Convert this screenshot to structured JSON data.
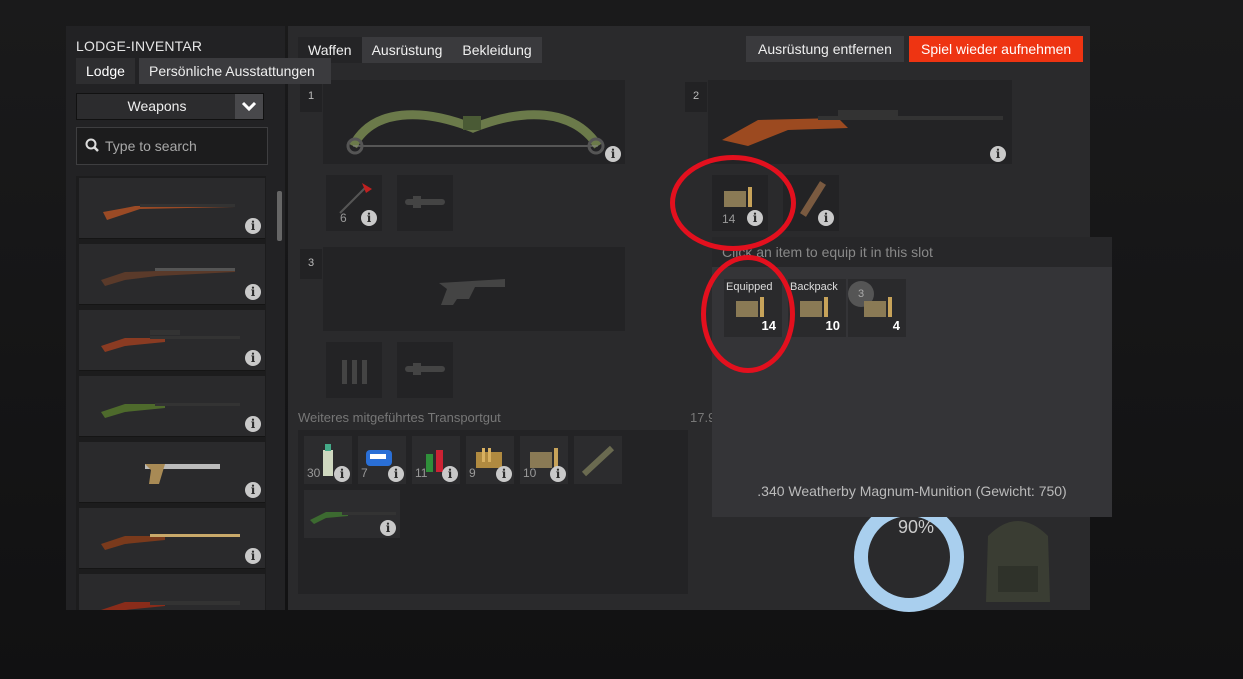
{
  "sidebar": {
    "title": "LODGE-INVENTAR",
    "tabs": [
      "Lodge",
      "Persönliche Ausstattungen"
    ],
    "category": "Weapons",
    "search_placeholder": "Type to search"
  },
  "tabs": [
    "Waffen",
    "Ausrüstung",
    "Bekleidung"
  ],
  "buttons": {
    "remove": "Ausrüstung entfernen",
    "resume": "Spiel wieder aufnehmen"
  },
  "slots": {
    "s1": "1",
    "s2": "2",
    "s3": "3",
    "s1_ammo_count": "6",
    "s2_ammo_count": "14"
  },
  "transport": {
    "label": "Weiteres mitgeführtes Transportgut",
    "counts": [
      "30",
      "7",
      "11",
      "9",
      "10"
    ]
  },
  "weight_partial": "17.9",
  "donut": {
    "percent": "90%",
    "value": 0.9
  },
  "popup": {
    "hint": "Click an item to equip it in this slot",
    "slots": [
      {
        "label": "Equipped",
        "count": "14"
      },
      {
        "label": "Backpack",
        "count": "10"
      },
      {
        "label": "3",
        "count": "4"
      }
    ],
    "description": ".340 Weatherby Magnum-Munition (Gewicht: 750)"
  },
  "colors": {
    "accent": "#ee3412",
    "highlight_ring": "#e3101e",
    "donut": "#a9cfee"
  }
}
